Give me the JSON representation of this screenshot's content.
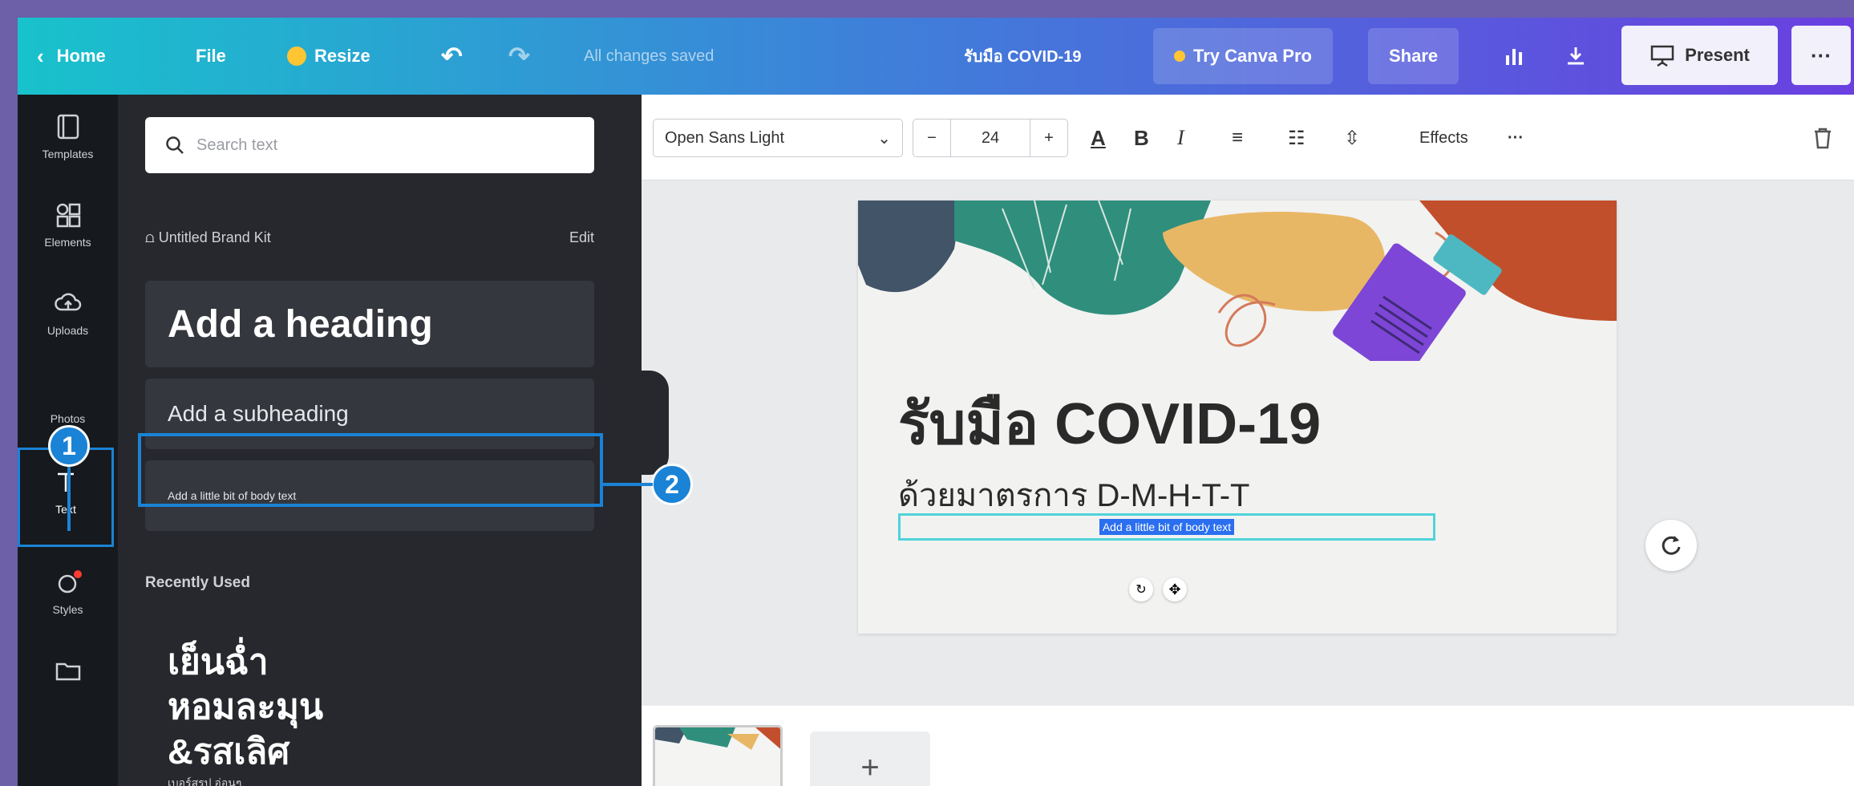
{
  "topbar": {
    "home": "Home",
    "file": "File",
    "resize": "Resize",
    "saved_status": "All changes saved",
    "doc_title": "รับมือ COVID-19",
    "try_pro": "Try Canva Pro",
    "share": "Share",
    "present": "Present",
    "more": "···"
  },
  "rail": {
    "templates": "Templates",
    "elements": "Elements",
    "uploads": "Uploads",
    "photos": "Photos",
    "text": "Text",
    "styles": "Styles"
  },
  "panel": {
    "search_placeholder": "Search text",
    "brand_kit": "Untitled Brand Kit",
    "edit": "Edit",
    "heading": "Add a heading",
    "subheading": "Add a subheading",
    "body": "Add a little bit of body text",
    "recently_used": "Recently Used",
    "thai_line1": "เย็นฉ่ำ",
    "thai_line2": "หอมละมุน",
    "thai_line3": "&รสเลิศ",
    "thai_caption": "เบอร์สรุป อ่อนๆ"
  },
  "toolbar": {
    "font": "Open Sans Light",
    "font_size": "24",
    "minus": "−",
    "plus": "+",
    "bold": "B",
    "italic": "I",
    "effects": "Effects",
    "more": "···"
  },
  "canvas": {
    "title": "รับมือ COVID-19",
    "subtitle": "ด้วยมาตรการ D-M-H-T-T",
    "selected_text": "Add a little bit of body text"
  },
  "annotations": {
    "badge1": "1",
    "badge2": "2"
  },
  "bottom": {
    "add_page": "+"
  },
  "colors": {
    "accent": "#1a83d6",
    "panel_bg": "#26282d",
    "rail_bg": "#16191d",
    "selection": "#2b6ff0"
  }
}
